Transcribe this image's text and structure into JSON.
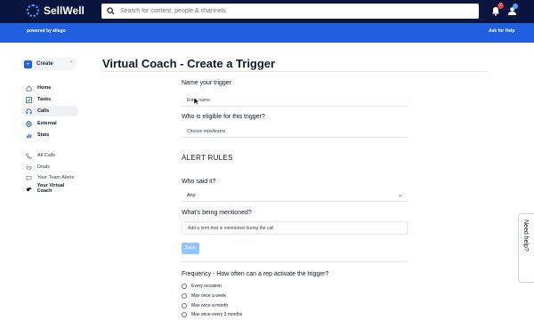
{
  "app": {
    "name": "SellWell",
    "search_placeholder": "Search for content, people & channels",
    "notifications_count": "2",
    "powered_by": "powered by allego",
    "ask_for_help": "Ask for Help"
  },
  "sidebar": {
    "create_label": "Create",
    "items": [
      {
        "label": "Home",
        "icon": "home-icon"
      },
      {
        "label": "Tasks",
        "icon": "check-icon"
      },
      {
        "label": "Calls",
        "icon": "headset-icon"
      },
      {
        "label": "External",
        "icon": "globe-icon"
      },
      {
        "label": "Stats",
        "icon": "chart-icon"
      }
    ],
    "sub_items": [
      {
        "label": "All Calls"
      },
      {
        "label": "Deals"
      },
      {
        "label": "Your Team Alerts"
      },
      {
        "label": "Your Virtual Coach"
      }
    ]
  },
  "page": {
    "title": "Virtual Coach - Create a Trigger",
    "name_label": "Name your trigger",
    "name_placeholder": "Enter name",
    "eligible_label": "Who is eligible for this trigger?",
    "eligible_placeholder": "Choose reps/teams",
    "alert_rules": "ALERT RULES",
    "who_said_label": "Who said it?",
    "who_said_value": "Any",
    "mentioned_label": "What's being mentioned?",
    "mentioned_placeholder": "Add a term that is mentioned during the call",
    "save_label": "Save",
    "frequency_label": "Frequency - How often can a rep activate the trigger?",
    "frequency_options": [
      "Every occasion",
      "Max once a week",
      "Max once a month",
      "Max once every 3 months"
    ]
  },
  "need_help": "Need help?"
}
